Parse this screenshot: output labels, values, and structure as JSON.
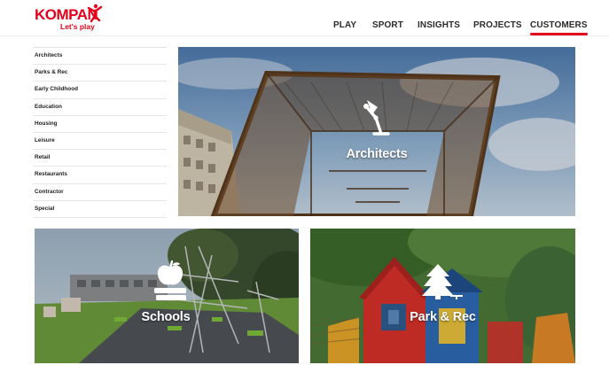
{
  "brand": {
    "name": "KOMPAN",
    "tagline": "Let's play",
    "accent": "#e3001b",
    "logo_icon": "jumping-figure-icon"
  },
  "nav": {
    "items": [
      {
        "label": "PLAY",
        "active": false
      },
      {
        "label": "SPORT",
        "active": false
      },
      {
        "label": "INSIGHTS",
        "active": false
      },
      {
        "label": "PROJECTS",
        "active": false
      },
      {
        "label": "CUSTOMERS",
        "active": true
      }
    ]
  },
  "sidebar": {
    "items": [
      {
        "label": "Architects"
      },
      {
        "label": "Parks & Rec"
      },
      {
        "label": "Early Childhood"
      },
      {
        "label": "Education"
      },
      {
        "label": "Housing"
      },
      {
        "label": "Leisure"
      },
      {
        "label": "Retail"
      },
      {
        "label": "Restaurants"
      },
      {
        "label": "Contractor"
      },
      {
        "label": "Special"
      }
    ]
  },
  "tiles": [
    {
      "label": "Architects",
      "icon": "desk-lamp-icon"
    },
    {
      "label": "Schools",
      "icon": "apple-on-books-icon"
    },
    {
      "label": "Park & Rec",
      "icon": "pine-tree-icon"
    }
  ]
}
